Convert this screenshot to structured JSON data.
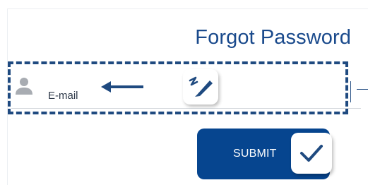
{
  "page": {
    "title": "Forgot Password"
  },
  "form": {
    "email": {
      "placeholder": "E-mail",
      "value": "",
      "icon": "user-icon"
    },
    "submit_label": "SUBMIT"
  },
  "annotations": {
    "highlight_icon": "dashed-highlight-box",
    "arrow_icon": "arrow-left-icon",
    "edit_icon": "edit-pen-icon",
    "check_icon": "checkmark-icon"
  },
  "colors": {
    "primary": "#06458f",
    "title": "#1a4a8c",
    "highlight": "#1f4a80",
    "icon_gray": "#a8acb2"
  }
}
